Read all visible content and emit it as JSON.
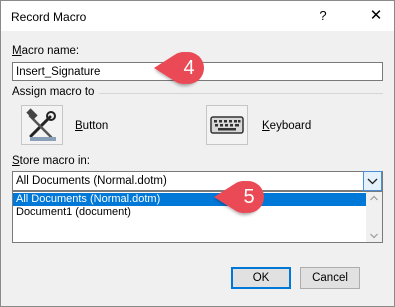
{
  "window": {
    "title": "Record Macro",
    "help": "?",
    "close": "✕"
  },
  "macro_name": {
    "label_key": "M",
    "label_rest": "acro name:",
    "value": "Insert_Signature"
  },
  "assign": {
    "label": "Assign macro to",
    "button_key": "B",
    "button_rest": "utton",
    "keyboard_key": "K",
    "keyboard_rest": "eyboard"
  },
  "store": {
    "label_key": "S",
    "label_rest": "tore macro in:",
    "selected": "All Documents (Normal.dotm)",
    "options": [
      "All Documents (Normal.dotm)",
      "Document1 (document)"
    ]
  },
  "buttons": {
    "ok": "OK",
    "cancel": "Cancel"
  },
  "callouts": {
    "step4": "4",
    "step5": "5",
    "color": "#ea4a55"
  }
}
